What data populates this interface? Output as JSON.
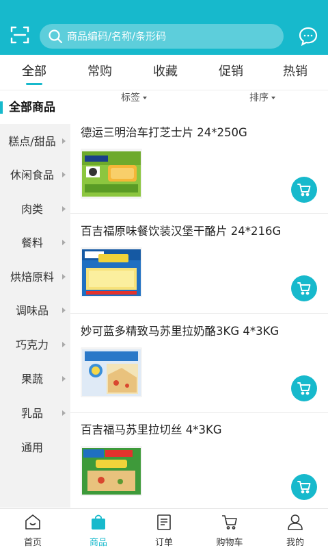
{
  "search": {
    "placeholder": "商品编码/名称/条形码"
  },
  "tabs": [
    {
      "label": "全部"
    },
    {
      "label": "常购"
    },
    {
      "label": "收藏"
    },
    {
      "label": "促销"
    },
    {
      "label": "热销"
    }
  ],
  "sidebar": {
    "active": "全部商品",
    "items": [
      {
        "label": "糕点/甜品"
      },
      {
        "label": "休闲食品"
      },
      {
        "label": "肉类"
      },
      {
        "label": "餐料"
      },
      {
        "label": "烘焙原料"
      },
      {
        "label": "调味品"
      },
      {
        "label": "巧克力"
      },
      {
        "label": "果蔬"
      },
      {
        "label": "乳品"
      },
      {
        "label": "通用"
      }
    ]
  },
  "filters": {
    "tag": "标签",
    "sort": "排序"
  },
  "products": [
    {
      "name": "德运三明治车打芝士片 24*250G",
      "image": "cheese-slices-green-pack"
    },
    {
      "name": "百吉福原味餐饮装汉堡干酪片 24*216G",
      "image": "cheese-slices-blue-pack"
    },
    {
      "name": "妙可蓝多精致马苏里拉奶酪3KG 4*3KG",
      "image": "mozzarella-bag"
    },
    {
      "name": "百吉福马苏里拉切丝 4*3KG",
      "image": "shredded-mozzarella-bag"
    }
  ],
  "bottom_nav": [
    {
      "label": "首页",
      "icon": "home-icon"
    },
    {
      "label": "商品",
      "icon": "bag-icon",
      "active": true
    },
    {
      "label": "订单",
      "icon": "order-icon"
    },
    {
      "label": "购物车",
      "icon": "cart-icon"
    },
    {
      "label": "我的",
      "icon": "user-icon"
    }
  ],
  "colors": {
    "accent": "#17b9cc",
    "sidebar_bg": "#f2f2f2"
  }
}
